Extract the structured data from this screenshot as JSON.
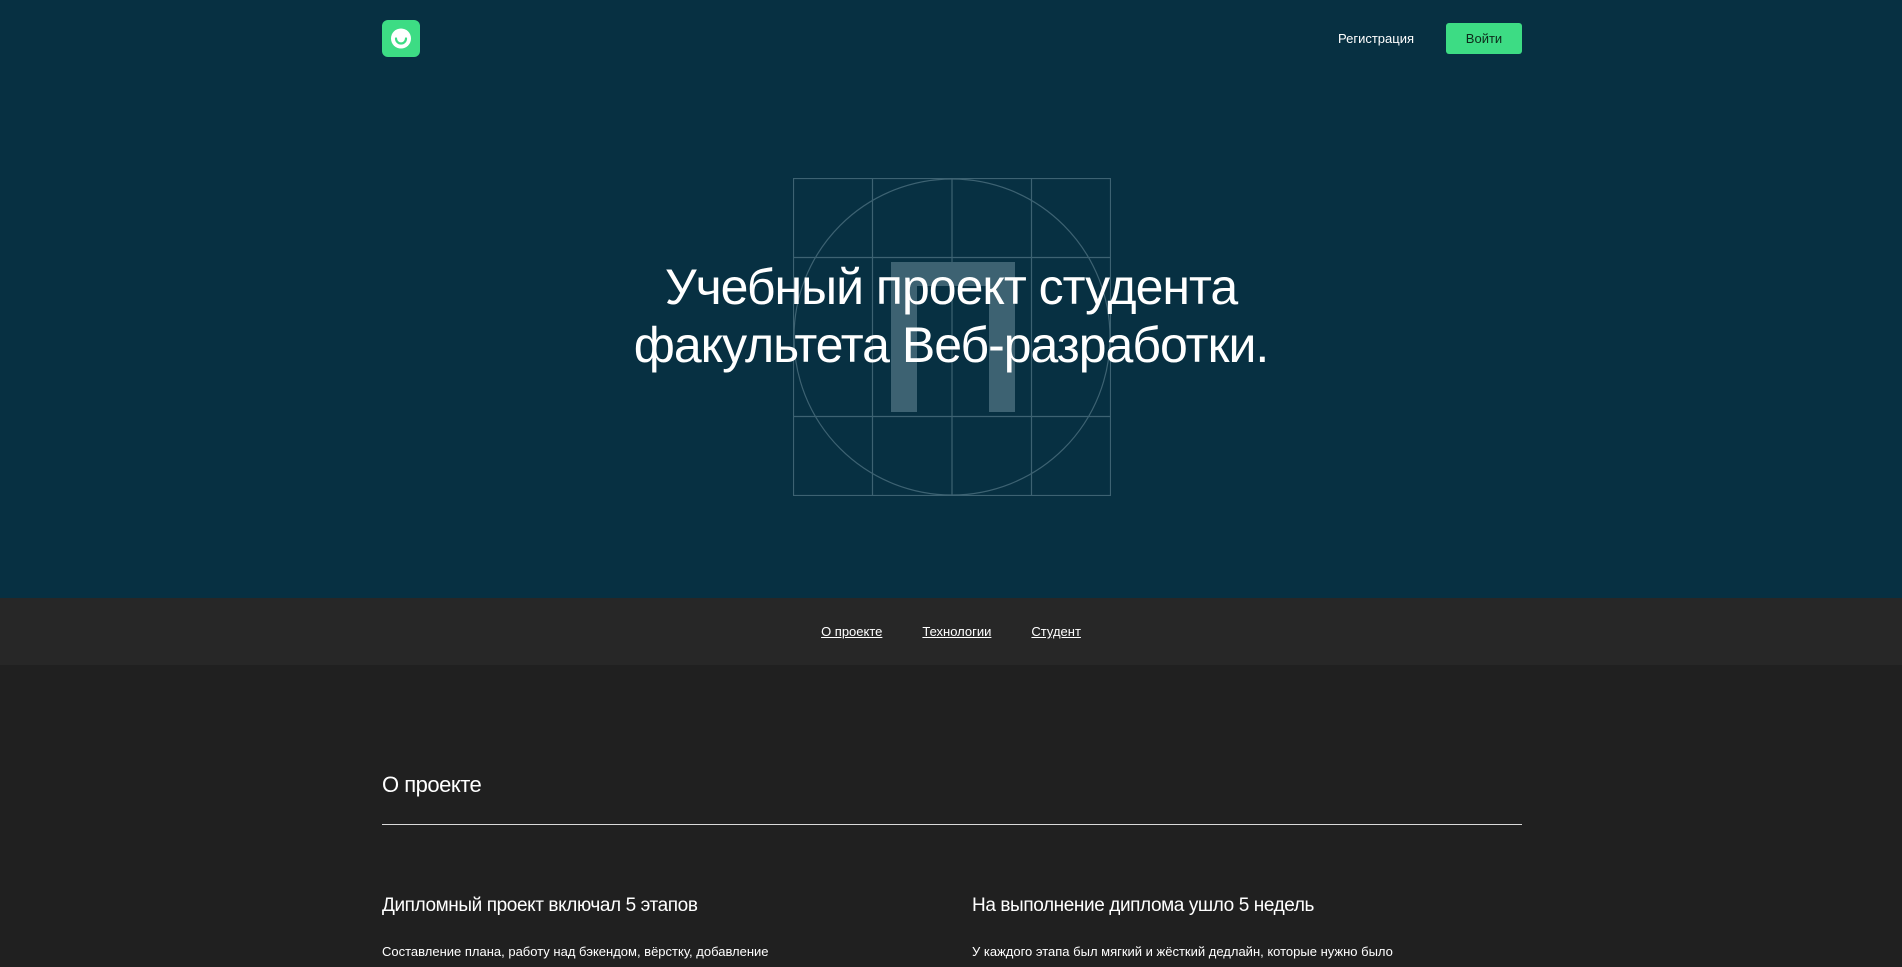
{
  "header": {
    "logo_icon": "smile-icon",
    "register_label": "Регистрация",
    "login_label": "Войти"
  },
  "hero": {
    "title_line1": "Учебный проект студента",
    "title_line2": "факультета Веб-разработки.",
    "background_art_icon": "grid-circle-p-icon"
  },
  "nav": {
    "items": [
      {
        "label": "О проекте"
      },
      {
        "label": "Технологии"
      },
      {
        "label": "Студент"
      }
    ]
  },
  "about": {
    "heading": "О проекте",
    "columns": [
      {
        "title": "Дипломный проект включал 5 этапов",
        "text": "Составление плана, работу над бэкендом, вёрстку, добавление"
      },
      {
        "title": "На выполнение диплома ушло 5 недель",
        "text": "У каждого этапа был мягкий и жёсткий дедлайн, которые нужно было"
      }
    ]
  },
  "colors": {
    "hero_bg": "#073042",
    "accent": "#3ddc84",
    "nav_bg": "#272727",
    "page_bg": "#202020"
  }
}
